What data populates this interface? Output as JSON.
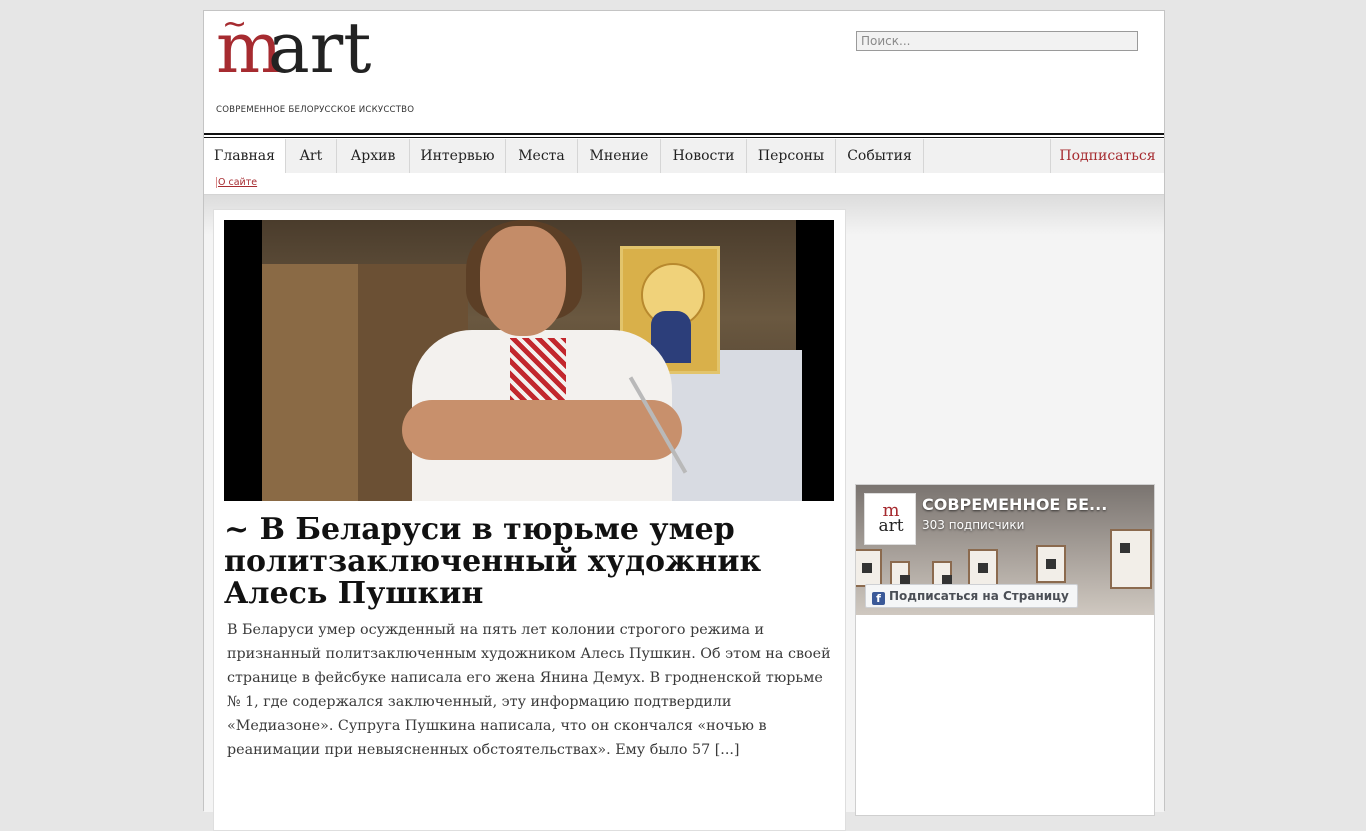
{
  "site": {
    "logo_tagline": "СОВРЕМЕННОЕ БЕЛОРУССКОЕ ИСКУССТВО",
    "logo_text": "mart",
    "search_placeholder": "Поиск..."
  },
  "nav": {
    "items": [
      "Главная",
      "Art",
      "Архив",
      "Интервью",
      "Места",
      "Мнение",
      "Новости",
      "Персоны",
      "События"
    ],
    "active": "Главная",
    "subscribe": "Подписаться",
    "sub_link": "О сайте"
  },
  "article": {
    "title": "~ В Беларуси в тюрьме умер политзаключенный художник Алесь Пушкин",
    "excerpt": "В Беларуси умер осужденный на пять лет колонии строгого режима и признанный политзаключенным художником Алесь Пушкин. Об этом на своей странице в фейсбуке написала его жена Янина Демух. В гродненской тюрьме № 1, где содержался заключенный, эту информацию подтвердили «Медиазоне». Супруга Пушкина написала, что он скончался «ночью в реанимации при невыясненных обстоятельствах». Ему было 57 [...]"
  },
  "facebook": {
    "page_name": "СОВРЕМЕННОЕ БЕ...",
    "followers": "303 подписчики",
    "follow_button": "Подписаться на Страницу",
    "avatar_top": "m",
    "avatar_bottom": "art"
  },
  "colors": {
    "brand": "#a62b30",
    "facebook": "#3b5998"
  }
}
